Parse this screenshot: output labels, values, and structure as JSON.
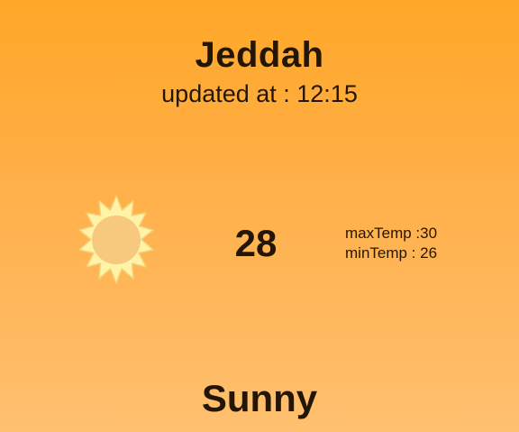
{
  "weather": {
    "city": "Jeddah",
    "updated": "updated at : 12:15",
    "temperature": "28",
    "max_temp": "maxTemp :30",
    "min_temp": "minTemp : 26",
    "condition": "Sunny",
    "icon": "sun-icon"
  },
  "colors": {
    "background_top": "#ffa728",
    "background_bottom": "#ffc070",
    "text": "#241606",
    "sun_rays": "#fff3a8",
    "sun_core": "#f6c97e"
  }
}
